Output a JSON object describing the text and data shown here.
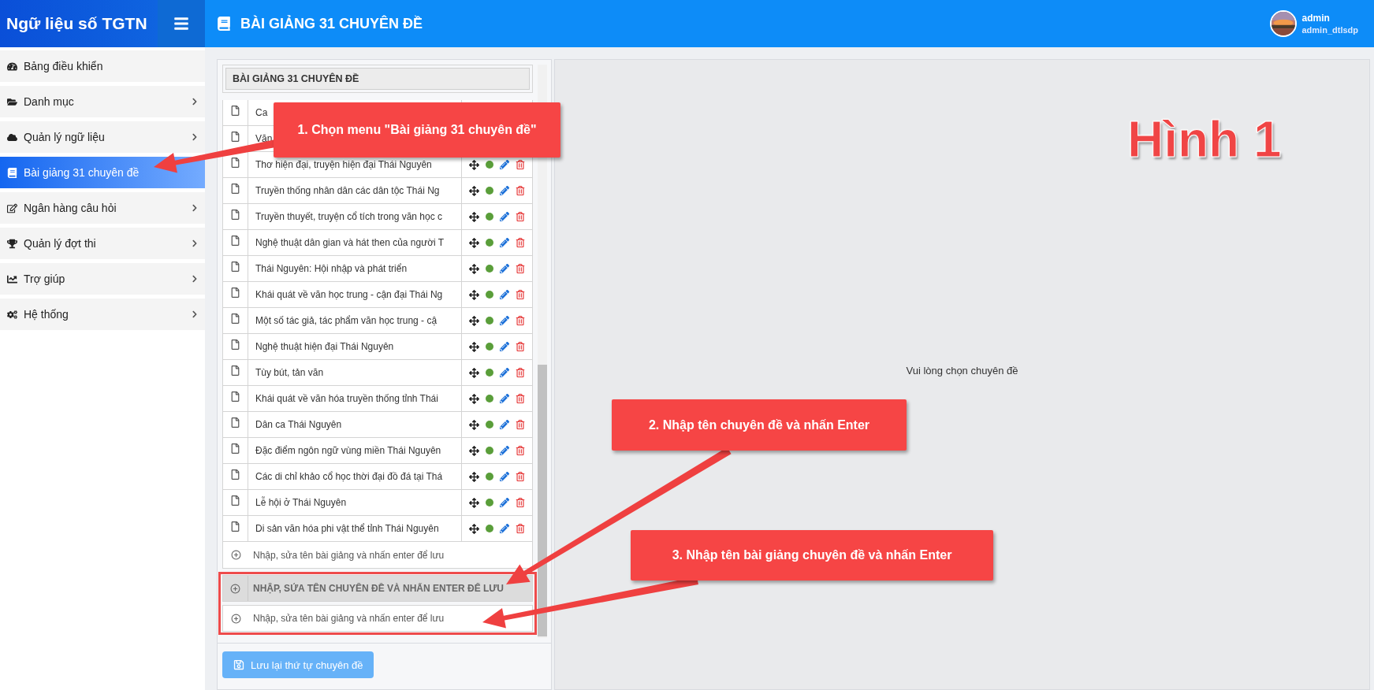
{
  "app": {
    "brand": "Ngữ liệu số TGTN"
  },
  "header": {
    "title": "BÀI GIẢNG 31 CHUYÊN ĐỀ",
    "user": {
      "name": "admin",
      "username": "admin_dtlsdp"
    }
  },
  "sidebar": {
    "items": [
      {
        "label": "Bảng điều khiển",
        "selected": false,
        "submenu": false
      },
      {
        "label": "Danh mục",
        "selected": false,
        "submenu": true
      },
      {
        "label": "Quản lý ngữ liệu",
        "selected": false,
        "submenu": true
      },
      {
        "label": "Bài giảng 31 chuyên đề",
        "selected": true,
        "submenu": false
      },
      {
        "label": "Ngân hàng câu hỏi",
        "selected": false,
        "submenu": true
      },
      {
        "label": "Quản lý đợt thi",
        "selected": false,
        "submenu": true
      },
      {
        "label": "Trợ giúp",
        "selected": false,
        "submenu": true
      },
      {
        "label": "Hệ thống",
        "selected": false,
        "submenu": true
      }
    ]
  },
  "lecture_panel": {
    "title": "BÀI GIẢNG 31 CHUYÊN ĐỀ",
    "lectures": [
      {
        "title": "Ca",
        "controls": false
      },
      {
        "title": "Văn",
        "controls": false
      },
      {
        "title": "Thơ hiện đại, truyện hiện đại Thái Nguyên"
      },
      {
        "title": "Truyền thống nhân dân các dân tộc Thái Ng"
      },
      {
        "title": "Truyền thuyết, truyện cổ tích trong văn học c"
      },
      {
        "title": "Nghệ thuật dân gian và hát then của người T"
      },
      {
        "title": "Thái Nguyên: Hội nhập và phát triển"
      },
      {
        "title": "Khái quát về văn học trung - cận đại Thái Ng"
      },
      {
        "title": "Một số tác giả, tác phẩm văn học  trung - cậ"
      },
      {
        "title": "Nghệ thuật hiện đại Thái Nguyên"
      },
      {
        "title": "Tùy bút, tản văn"
      },
      {
        "title": "Khái quát về văn hóa truyền thống tỉnh Thái"
      },
      {
        "title": "Dân ca Thái Nguyên"
      },
      {
        "title": "Đặc điểm ngôn ngữ vùng miền Thái Nguyên"
      },
      {
        "title": "Các di chỉ khảo cổ học thời đại đồ đá tại Thá"
      },
      {
        "title": "Lễ hội ở Thái Nguyên"
      },
      {
        "title": "Di sản văn hóa phi vật thể tỉnh Thái Nguyên"
      }
    ],
    "new_lecture_placeholder": "Nhập, sửa tên bài giảng và nhấn enter để lưu",
    "new_topic_placeholder": "NHẬP, SỬA TÊN CHUYÊN ĐỀ VÀ NHẤN ENTER ĐỂ LƯU",
    "new_topic_lecture_placeholder": "Nhập, sửa tên bài giảng và nhấn enter để lưu",
    "save_button": {
      "label": "Lưu lại thứ tự chuyên đề",
      "disabled": true
    }
  },
  "detail_panel": {
    "message": "Vui lòng chọn chuyên đề"
  },
  "annotations": [
    {
      "kind": "callout",
      "text": "1. Chọn menu \"Bài giảng 31 chuyên đề\""
    },
    {
      "kind": "callout",
      "text": "2. Nhập tên chuyên đề và nhấn Enter"
    },
    {
      "kind": "callout",
      "text": "3. Nhập tên bài giảng chuyên đề và nhấn Enter"
    },
    {
      "kind": "label",
      "text": "Hình 1"
    }
  ]
}
